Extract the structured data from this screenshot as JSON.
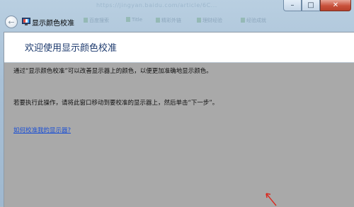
{
  "window": {
    "title": "显示颜色校准",
    "buttons": {
      "minimize": "–",
      "maximize": "□",
      "close": "✕"
    }
  },
  "background_browser": {
    "url_fragment": "https://jingyan.baidu.com/article/6C...",
    "bookmarks": [
      "百度搜索",
      "Title",
      "精彩外链",
      "理财经验",
      "经验成就"
    ]
  },
  "page": {
    "heading": "欢迎使用显示颜色校准",
    "paragraph1": "通过“显示颜色校准”可以改善显示器上的颜色，以便更加准确地显示颜色。",
    "paragraph2": "若要执行此操作，请将此窗口移动到要校准的显示器上，然后单击“下一步”。",
    "link": "如何校准我的显示器?"
  },
  "colors": {
    "heading": "#1d3a6e",
    "link": "#1a4fd4",
    "client_background": "#a9a9a9",
    "arrow": "#d9281e"
  },
  "icons": {
    "back": "back-arrow-icon",
    "title": "display-calibration-icon",
    "pointer": "red-arrow-icon"
  }
}
